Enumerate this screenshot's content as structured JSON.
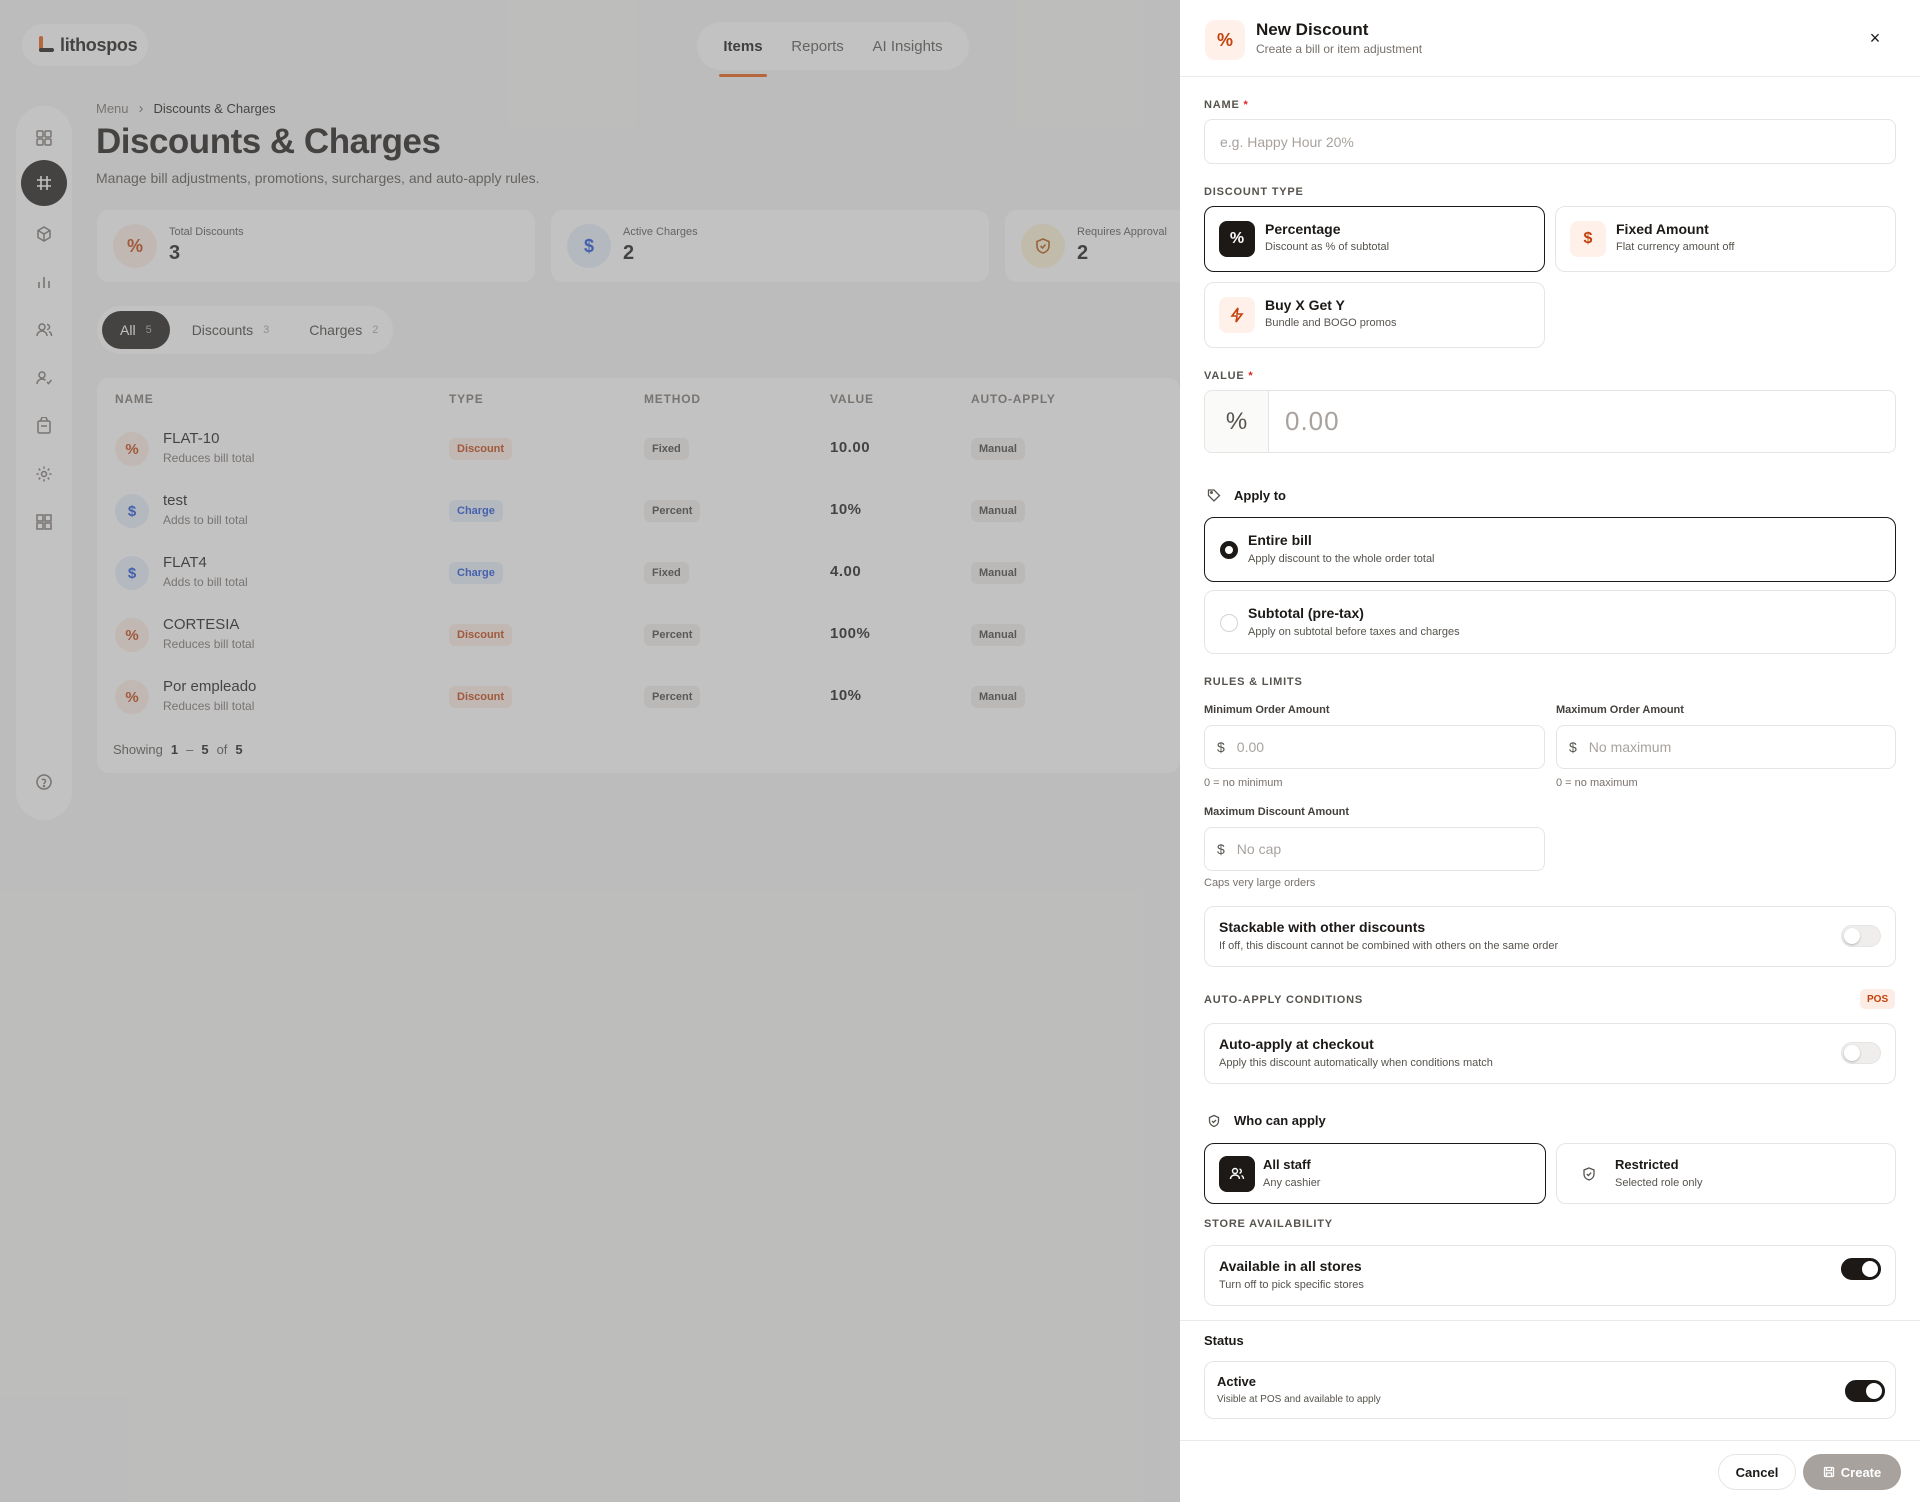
{
  "app": {
    "logo_text": "lithospos",
    "nav_tabs": [
      {
        "label": "Items"
      },
      {
        "label": "Reports"
      },
      {
        "label": "AI Insights"
      }
    ]
  },
  "breadcrumb": {
    "root": "Menu",
    "current": "Discounts & Charges"
  },
  "page": {
    "title": "Discounts & Charges",
    "subtitle": "Manage bill adjustments, promotions, surcharges, and auto-apply rules."
  },
  "stats": [
    {
      "label": "Total Discounts",
      "value": "3",
      "icon": "%"
    },
    {
      "label": "Active Charges",
      "value": "2",
      "icon": "$"
    },
    {
      "label": "Requires Approval",
      "value": "2",
      "icon": "shield"
    }
  ],
  "filters": [
    {
      "label": "All",
      "count": "5"
    },
    {
      "label": "Discounts",
      "count": "3"
    },
    {
      "label": "Charges",
      "count": "2"
    }
  ],
  "table": {
    "columns": [
      "NAME",
      "TYPE",
      "METHOD",
      "VALUE",
      "AUTO-APPLY"
    ],
    "rows": [
      {
        "icon": "%",
        "name": "FLAT-10",
        "desc": "Reduces bill total",
        "type": "Discount",
        "method": "Fixed",
        "value": "10.00",
        "auto": "Manual"
      },
      {
        "icon": "$",
        "name": "test",
        "desc": "Adds to bill total",
        "type": "Charge",
        "method": "Percent",
        "value": "10%",
        "auto": "Manual"
      },
      {
        "icon": "$",
        "name": "FLAT4",
        "desc": "Adds to bill total",
        "type": "Charge",
        "method": "Fixed",
        "value": "4.00",
        "auto": "Manual"
      },
      {
        "icon": "%",
        "name": "CORTESIA",
        "desc": "Reduces bill total",
        "type": "Discount",
        "method": "Percent",
        "value": "100%",
        "auto": "Manual"
      },
      {
        "icon": "%",
        "name": "Por empleado",
        "desc": "Reduces bill total",
        "type": "Discount",
        "method": "Percent",
        "value": "10%",
        "auto": "Manual"
      }
    ],
    "footer": {
      "showing": "Showing",
      "from": "1",
      "dash": "–",
      "to": "5",
      "of": "of",
      "total": "5"
    }
  },
  "panel": {
    "icon": "%",
    "title": "New Discount",
    "subtitle": "Create a bill or item adjustment",
    "close": "×",
    "name": {
      "label": "NAME",
      "required": "*",
      "placeholder": "e.g. Happy Hour 20%"
    },
    "discount_type": {
      "label": "DISCOUNT TYPE",
      "options": [
        {
          "title": "Percentage",
          "desc": "Discount as % of subtotal",
          "icon": "%",
          "selected": true
        },
        {
          "title": "Fixed Amount",
          "desc": "Flat currency amount off",
          "icon": "$",
          "selected": false
        },
        {
          "title": "Buy X Get Y",
          "desc": "Bundle and BOGO promos",
          "icon": "bolt",
          "selected": false
        }
      ]
    },
    "value": {
      "label": "VALUE",
      "required": "*",
      "prefix": "%",
      "placeholder": "0.00"
    },
    "apply_to": {
      "label": "Apply to",
      "options": [
        {
          "title": "Entire bill",
          "desc": "Apply discount to the whole order total",
          "selected": true
        },
        {
          "title": "Subtotal (pre-tax)",
          "desc": "Apply on subtotal before taxes and charges",
          "selected": false
        }
      ]
    },
    "rules": {
      "label": "RULES & LIMITS",
      "min_order": {
        "label": "Minimum Order Amount",
        "prefix": "$",
        "placeholder": "0.00",
        "hint": "0 = no minimum"
      },
      "max_order": {
        "label": "Maximum Order Amount",
        "prefix": "$",
        "placeholder": "No maximum",
        "hint": "0 = no maximum"
      },
      "max_discount": {
        "label": "Maximum Discount Amount",
        "prefix": "$",
        "placeholder": "No cap",
        "hint": "Caps very large orders"
      },
      "stackable": {
        "title": "Stackable with other discounts",
        "desc": "If off, this discount cannot be combined with others on the same order",
        "on": false
      }
    },
    "auto_apply": {
      "label": "AUTO-APPLY CONDITIONS",
      "badge": "POS",
      "title": "Auto-apply at checkout",
      "desc": "Apply this discount automatically when conditions match",
      "on": false
    },
    "who_can_apply": {
      "label": "Who can apply",
      "options": [
        {
          "title": "All staff",
          "desc": "Any cashier",
          "selected": true
        },
        {
          "title": "Restricted",
          "desc": "Selected role only",
          "selected": false
        }
      ]
    },
    "store": {
      "label": "STORE AVAILABILITY",
      "title": "Available in all stores",
      "desc": "Turn off to pick specific stores",
      "on": true
    },
    "status": {
      "label": "Status",
      "title": "Active",
      "desc": "Visible at POS and available to apply",
      "on": true
    },
    "footer": {
      "cancel": "Cancel",
      "create": "Create"
    }
  },
  "colors": {
    "accent": "#ea580c",
    "dark": "#1c1917",
    "discount_tag_bg": "#fdece3",
    "discount_tag_fg": "#c2410c",
    "charge_tag_bg": "#e6eefc",
    "charge_tag_fg": "#1d4ed8",
    "overlay": "rgba(120,120,120,0.45)"
  }
}
